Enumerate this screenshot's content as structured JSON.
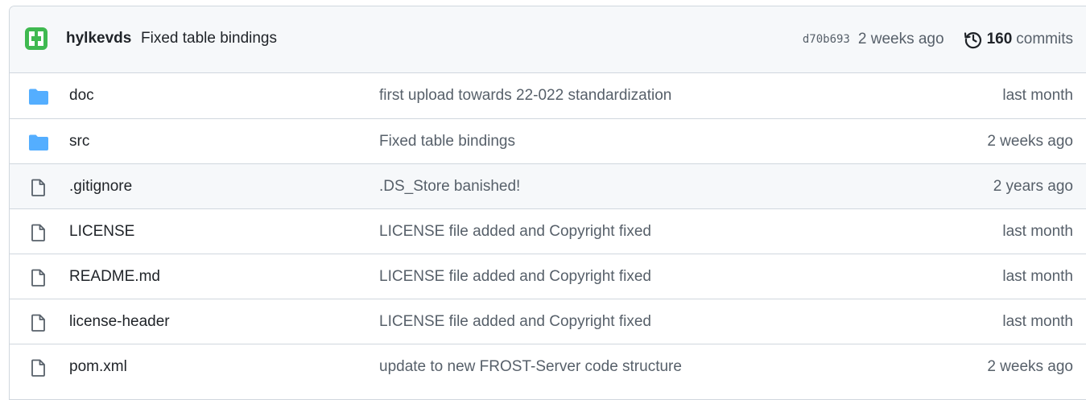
{
  "latest_commit": {
    "author": "hylkevds",
    "message": "Fixed table bindings",
    "sha": "d70b693",
    "age": "2 weeks ago",
    "commit_count": "160",
    "commits_label": "commits",
    "avatar_color": "#3fb950"
  },
  "colors": {
    "folder_icon": "#54aeff",
    "file_icon": "#57606a",
    "border": "#d0d7de",
    "header_bg": "#f6f8fa",
    "muted_text": "#57606a"
  },
  "files": [
    {
      "type": "folder",
      "icon": "folder-icon",
      "name": "doc",
      "message": "first upload towards 22-022 standardization",
      "age": "last month"
    },
    {
      "type": "folder",
      "icon": "folder-icon",
      "name": "src",
      "message": "Fixed table bindings",
      "age": "2 weeks ago"
    },
    {
      "type": "file",
      "icon": "file-icon",
      "name": ".gitignore",
      "message": ".DS_Store banished!",
      "age": "2 years ago",
      "hovered": true
    },
    {
      "type": "file",
      "icon": "file-icon",
      "name": "LICENSE",
      "message": "LICENSE file added and Copyright fixed",
      "age": "last month"
    },
    {
      "type": "file",
      "icon": "file-icon",
      "name": "README.md",
      "message": "LICENSE file added and Copyright fixed",
      "age": "last month"
    },
    {
      "type": "file",
      "icon": "file-icon",
      "name": "license-header",
      "message": "LICENSE file added and Copyright fixed",
      "age": "last month"
    },
    {
      "type": "file",
      "icon": "file-icon",
      "name": "pom.xml",
      "message": "update to new FROST-Server code structure",
      "age": "2 weeks ago"
    }
  ]
}
